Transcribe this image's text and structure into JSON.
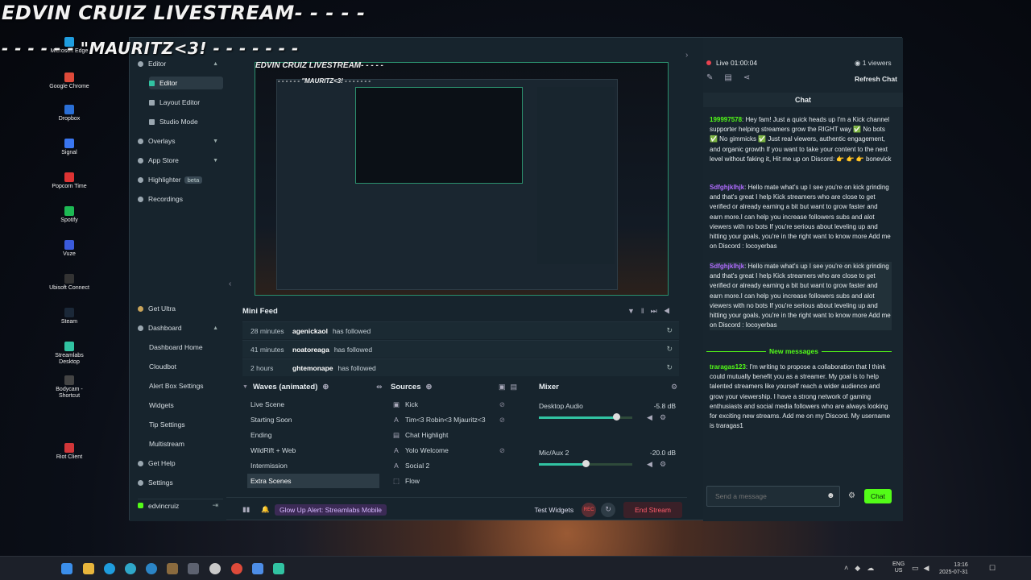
{
  "overlay": {
    "line1": "EDVIN CRUIZ LIVESTREAM- - - - -",
    "line2": "- - - - - - \"MAURITZ<3! - - - - - - -"
  },
  "desktop_icons": [
    {
      "label": "Microsoft Edge"
    },
    {
      "label": "Google Chrome"
    },
    {
      "label": "Dropbox"
    },
    {
      "label": "Signal"
    },
    {
      "label": "Popcorn Time"
    },
    {
      "label": "Spotify"
    },
    {
      "label": "Vuze"
    },
    {
      "label": "Ubisoft Connect"
    },
    {
      "label": "Steam"
    },
    {
      "label": "Streamlabs Desktop"
    },
    {
      "label": "Bodycam - Shortcut"
    },
    {
      "label": "Riot Client"
    }
  ],
  "sidebar": {
    "editor": "Editor",
    "editor_sub": "Editor",
    "layout_editor": "Layout Editor",
    "studio_mode": "Studio Mode",
    "overlays": "Overlays",
    "app_store": "App Store",
    "highlighter": "Highlighter",
    "beta": "beta",
    "recordings": "Recordings",
    "get_ultra": "Get Ultra",
    "dashboard": "Dashboard",
    "dashboard_home": "Dashboard Home",
    "cloudbot": "Cloudbot",
    "alert_box": "Alert Box Settings",
    "widgets": "Widgets",
    "tip_settings": "Tip Settings",
    "multistream": "Multistream",
    "get_help": "Get Help",
    "settings": "Settings",
    "user": "edvincruiz"
  },
  "mini_feed": {
    "title": "Mini Feed",
    "rows": [
      {
        "time": "28 minutes",
        "name": "agenickaol",
        "action": "has followed"
      },
      {
        "time": "41 minutes",
        "name": "noatoreaga",
        "action": "has followed"
      },
      {
        "time": "2 hours",
        "name": "ghtemonape",
        "action": "has followed"
      }
    ]
  },
  "scenes": {
    "title": "Waves (animated)",
    "items": [
      "Live Scene",
      "Starting Soon",
      "Ending",
      "WildRift + Web",
      "Intermission",
      "Extra Scenes"
    ]
  },
  "sources": {
    "title": "Sources",
    "items": [
      {
        "icon": "kick-icon",
        "label": "Kick"
      },
      {
        "icon": "text-icon",
        "label": "Tim<3 Robin<3 Mjauritz<3"
      },
      {
        "icon": "chat-icon",
        "label": "Chat Highlight"
      },
      {
        "icon": "text-icon",
        "label": "Yolo Welcome"
      },
      {
        "icon": "text-icon",
        "label": "Social 2"
      },
      {
        "icon": "folder-icon",
        "label": "Flow"
      }
    ]
  },
  "mixer": {
    "title": "Mixer",
    "channels": [
      {
        "name": "Desktop Audio",
        "db": "-5.8 dB",
        "level": 0.83
      },
      {
        "name": "Mic/Aux 2",
        "db": "-20.0 dB",
        "level": 0.5
      }
    ]
  },
  "footer": {
    "alert": "Glow Up Alert: Streamlabs Mobile",
    "test_widgets": "Test Widgets",
    "rec": "REC",
    "end_stream": "End Stream"
  },
  "chat": {
    "live": "Live 01:00:04",
    "viewers": "1 viewers",
    "refresh": "Refresh Chat",
    "title": "Chat",
    "new_messages": "New messages",
    "placeholder": "Send a message",
    "send": "Chat",
    "messages": [
      {
        "user": "199997578",
        "text": "Hey fam! Just a quick heads up I'm a Kick channel supporter helping streamers grow the RIGHT way ✅ No bots ✅ No gimmicks ✅ Just real viewers, authentic engagement, and organic growth If you want to take your content to the next level without faking it, Hit me up on Discord: 👉 👉 👉 bonevick"
      },
      {
        "user": "Sdfghjklhjk",
        "text": "Hello mate what's up I see you're on kick grinding and that's great I help Kick streamers who are close to get verified or already earning a bit but want to grow faster and earn more.I can help you increase followers subs and alot viewers with no bots If you're serious about leveling up and hitting your goals, you're in the right want to know more Add me on Discord : locoyerbas"
      },
      {
        "user": "Sdfghjklhjk",
        "text": "Hello mate what's up I see you're on kick grinding and that's great I help Kick streamers who are close to get verified or already earning a bit but want to grow faster and earn more.I can help you increase followers subs and alot viewers with no bots If you're serious about leveling up and hitting your goals, you're in the right want to know more Add me on Discord : locoyerbas"
      },
      {
        "user": "traragas123",
        "text": "I'm writing to propose a collaboration that I think could mutually benefit you as a streamer. My goal is to help talented streamers like yourself reach a wider audience and grow your viewership. I have a strong network of gaming enthusiasts and social media followers who are always looking for exciting new streams. Add me on my Discord. My username is traragas1"
      }
    ]
  },
  "tray": {
    "lang1": "ENG",
    "lang2": "US",
    "time": "13:16",
    "date": "2025-07-31"
  }
}
